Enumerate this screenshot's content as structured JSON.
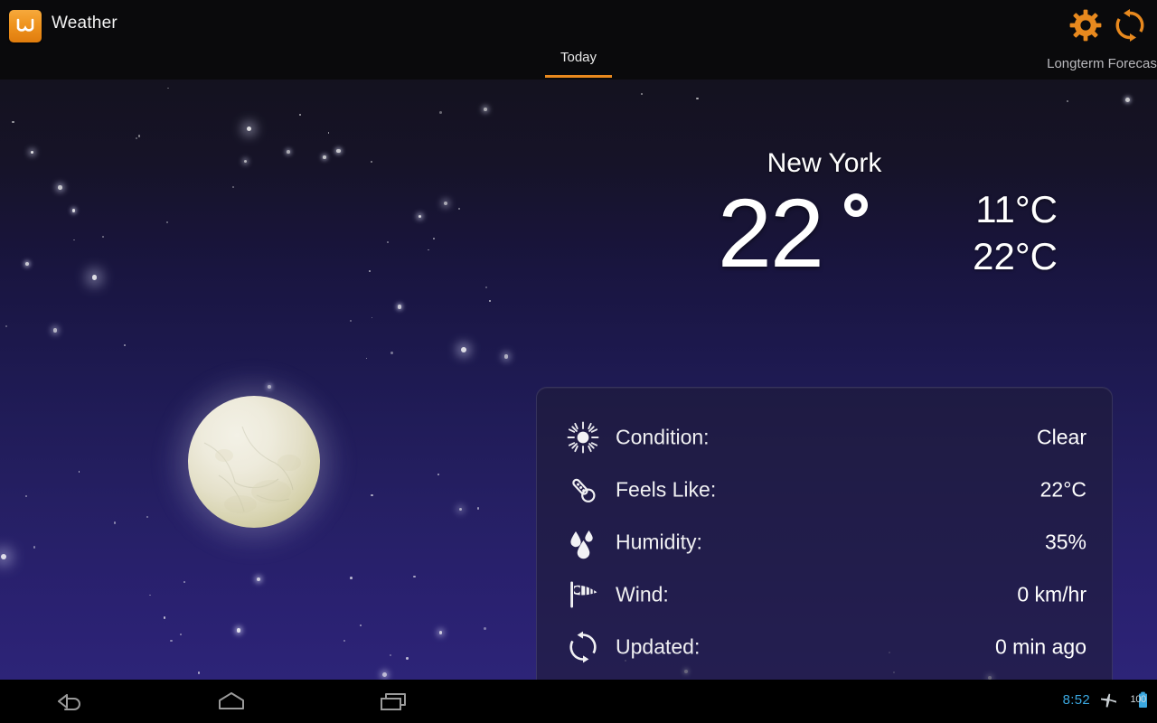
{
  "app": {
    "title": "Weather",
    "icon": "weather-app-icon"
  },
  "actionbar": {
    "tab_today": "Today",
    "longterm_label": "Longterm Forecast",
    "settings_icon": "gear-icon",
    "refresh_icon": "refresh-icon",
    "accent_color": "#e8891e"
  },
  "current": {
    "city": "New York",
    "temperature": "22",
    "degree_symbol": "°",
    "high": "11°C",
    "low": "22°C"
  },
  "details": {
    "rows": [
      {
        "icon": "sun-icon",
        "label": "Condition:",
        "value": "Clear"
      },
      {
        "icon": "thermometer-icon",
        "label": "Feels Like:",
        "value": "22°C"
      },
      {
        "icon": "humidity-icon",
        "label": "Humidity:",
        "value": "35%"
      },
      {
        "icon": "windsock-icon",
        "label": "Wind:",
        "value": "0 km/hr"
      },
      {
        "icon": "refresh-icon",
        "label": "Updated:",
        "value": "0 min ago"
      }
    ]
  },
  "scene": {
    "illustration": "night-moon-starfield",
    "moon_color": "#e7e3ce",
    "sky_top": "#14121f",
    "sky_bottom": "#2d2478"
  },
  "statusbar": {
    "time": "8:52",
    "time_color": "#3ba8e0",
    "airplane_icon": "airplane-mode-icon",
    "battery_icon": "battery-icon",
    "battery_level": "100"
  },
  "navbar": {
    "back": "back-icon",
    "home": "home-icon",
    "recents": "recent-apps-icon"
  }
}
